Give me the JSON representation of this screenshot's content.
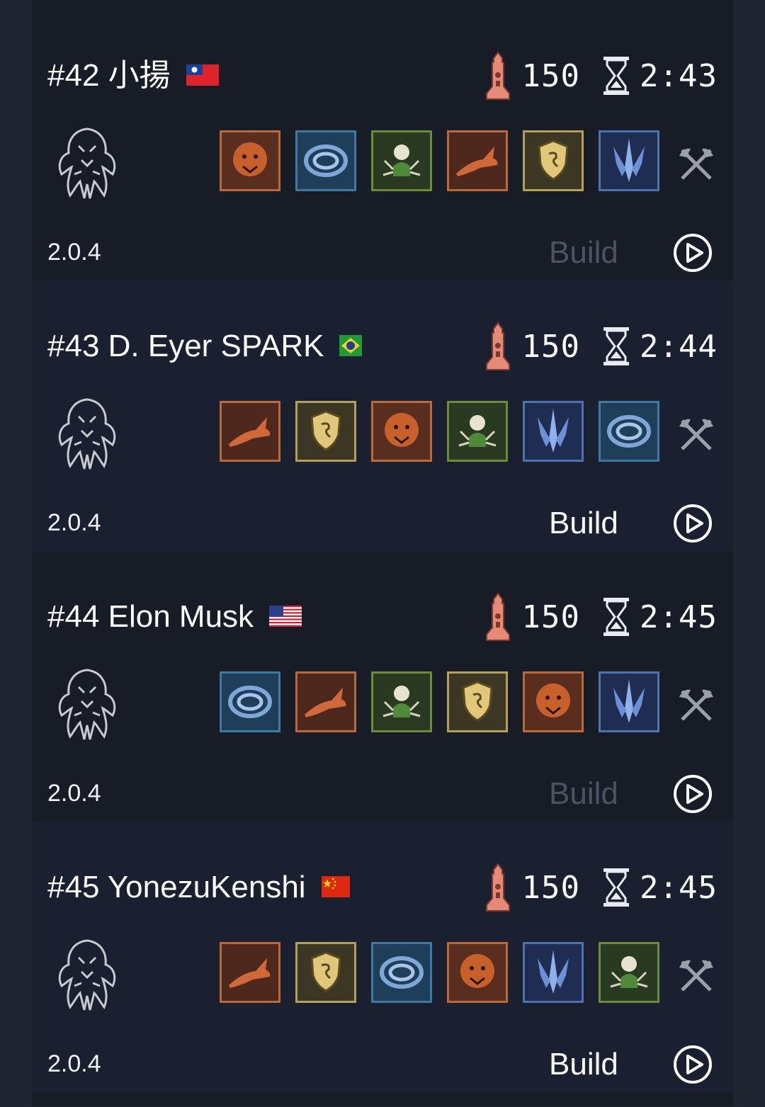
{
  "entries": [
    {
      "rank_name": "#42 小揚",
      "flag": "taiwan",
      "level": "150",
      "time": "2:43",
      "version": "2.0.4",
      "build_label": "Build",
      "build_enabled": false,
      "glyphs": [
        "jaguar",
        "water-vortex",
        "skull-spider",
        "wolf-dash",
        "shield",
        "ice-blades"
      ]
    },
    {
      "rank_name": "#43 D. Eyer SPARK",
      "flag": "brazil",
      "level": "150",
      "time": "2:44",
      "version": "2.0.4",
      "build_label": "Build",
      "build_enabled": true,
      "glyphs": [
        "wolf-dash",
        "shield",
        "jaguar",
        "skull-spider",
        "ice-blades",
        "water-vortex"
      ]
    },
    {
      "rank_name": "#44 Elon Musk",
      "flag": "usa",
      "level": "150",
      "time": "2:45",
      "version": "2.0.4",
      "build_label": "Build",
      "build_enabled": false,
      "glyphs": [
        "water-vortex",
        "wolf-dash",
        "skull-spider",
        "shield",
        "jaguar",
        "ice-blades"
      ]
    },
    {
      "rank_name": "#45 YonezuKenshi",
      "flag": "china",
      "level": "150",
      "time": "2:45",
      "version": "2.0.4",
      "build_label": "Build",
      "build_enabled": true,
      "glyphs": [
        "wolf-dash",
        "shield",
        "water-vortex",
        "jaguar",
        "ice-blades",
        "skull-spider"
      ]
    }
  ],
  "colors": {
    "card_bg": "#171c27",
    "page_bg": "#1f2632",
    "tower": "#e48a76",
    "build_dim": "#4b5363",
    "text": "#ffffff"
  }
}
